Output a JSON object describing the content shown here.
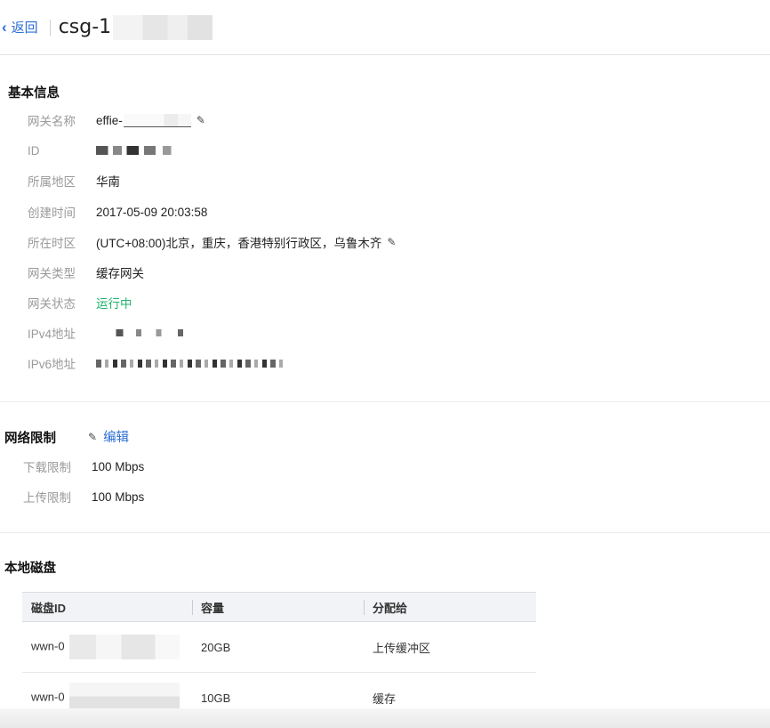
{
  "header": {
    "back_label": "返回",
    "title": "csg-1"
  },
  "basic_info": {
    "title": "基本信息",
    "rows": [
      {
        "label": "网关名称",
        "value": "effie-"
      },
      {
        "label": "ID",
        "value": ""
      },
      {
        "label": "所属地区",
        "value": "华南"
      },
      {
        "label": "创建时间",
        "value": "2017-05-09 20:03:58"
      },
      {
        "label": "所在时区",
        "value": "(UTC+08:00)北京，重庆，香港特别行政区，乌鲁木齐"
      },
      {
        "label": "网关类型",
        "value": "缓存网关"
      },
      {
        "label": "网关状态",
        "value": "运行中"
      },
      {
        "label": "IPv4地址",
        "value": ""
      },
      {
        "label": "IPv6地址",
        "value": ""
      }
    ]
  },
  "network_limit": {
    "title": "网络限制",
    "edit_label": "编辑",
    "rows": [
      {
        "label": "下载限制",
        "value": "100 Mbps"
      },
      {
        "label": "上传限制",
        "value": "100 Mbps"
      }
    ]
  },
  "local_disks": {
    "title": "本地磁盘",
    "columns": [
      "磁盘ID",
      "容量",
      "分配给"
    ],
    "rows": [
      {
        "disk_id": "wwn-0",
        "capacity": "20GB",
        "assigned": "上传缓冲区"
      },
      {
        "disk_id": "wwn-0",
        "capacity": "10GB",
        "assigned": "缓存"
      }
    ]
  },
  "colors": {
    "link": "#2d6fd6",
    "status_running": "#21b26b",
    "label_gray": "#9a9a9a"
  }
}
